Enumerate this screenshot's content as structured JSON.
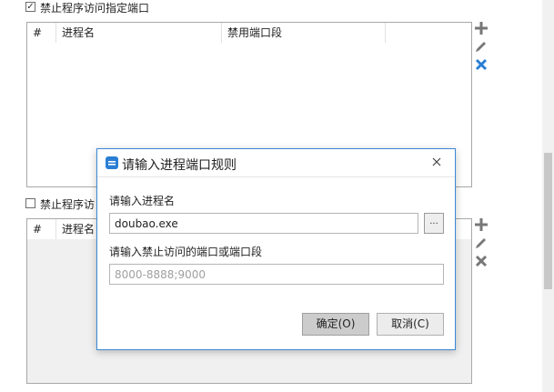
{
  "section1": {
    "checkbox_checked": true,
    "checkbox_mark": "✓",
    "label": "禁止程序访问指定端口",
    "columns": [
      "#",
      "进程名",
      "禁用端口段"
    ]
  },
  "section2": {
    "checkbox_checked": false,
    "label": "禁止程序访",
    "columns": [
      "#",
      "进程名"
    ]
  },
  "side_icons": [
    "plus-icon",
    "pencil-icon",
    "close-icon"
  ],
  "colors": {
    "accent": "#2a7fd4",
    "icon_gray": "#777777",
    "dialog_border": "#3c88d5"
  },
  "dialog": {
    "title": "请输入进程端口规则",
    "close_glyph": "✕",
    "process_label": "请输入进程名",
    "process_value": "doubao.exe",
    "browse_label": "...",
    "port_label": "请输入禁止访问的端口或端口段",
    "port_placeholder": "8000-8888;9000",
    "ok_label": "确定(O)",
    "cancel_label": "取消(C)"
  }
}
